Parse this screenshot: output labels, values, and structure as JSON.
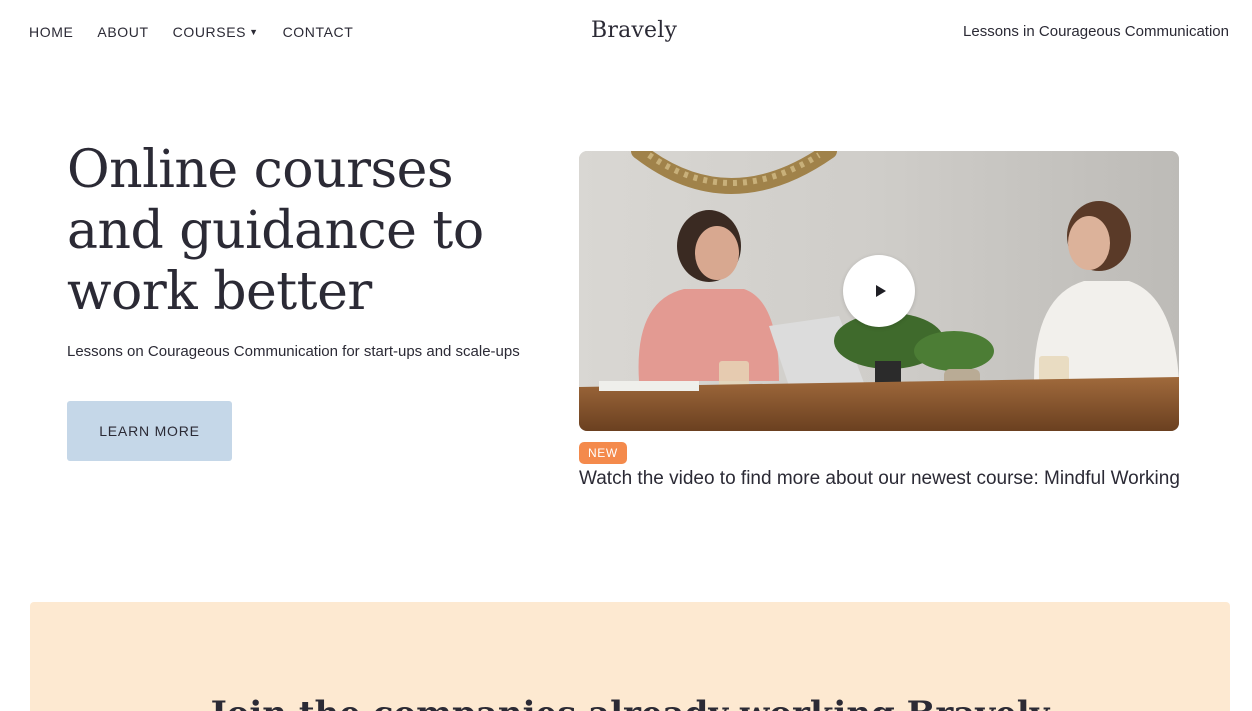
{
  "nav": {
    "items": [
      {
        "label": "HOME"
      },
      {
        "label": "ABOUT"
      },
      {
        "label": "COURSES",
        "has_dropdown": true
      },
      {
        "label": "CONTACT"
      }
    ]
  },
  "brand": {
    "logo": "Bravely",
    "tagline": "Lessons in Courageous Communication"
  },
  "hero": {
    "title": "Online courses and guidance to work better",
    "subtitle": "Lessons on Courageous Communication for start-ups and scale-ups",
    "cta_label": "LEARN MORE"
  },
  "video": {
    "badge": "NEW",
    "caption": "Watch the video to find more about our newest course: Mindful Working"
  },
  "join": {
    "title": "Join the companies already working Bravely"
  },
  "colors": {
    "text": "#2b2a35",
    "button_bg": "#c5d7e8",
    "badge_bg": "#f48a4c",
    "join_bg": "#fde9d1"
  },
  "icons": {
    "dropdown": "caret-down-icon",
    "play": "play-icon"
  }
}
